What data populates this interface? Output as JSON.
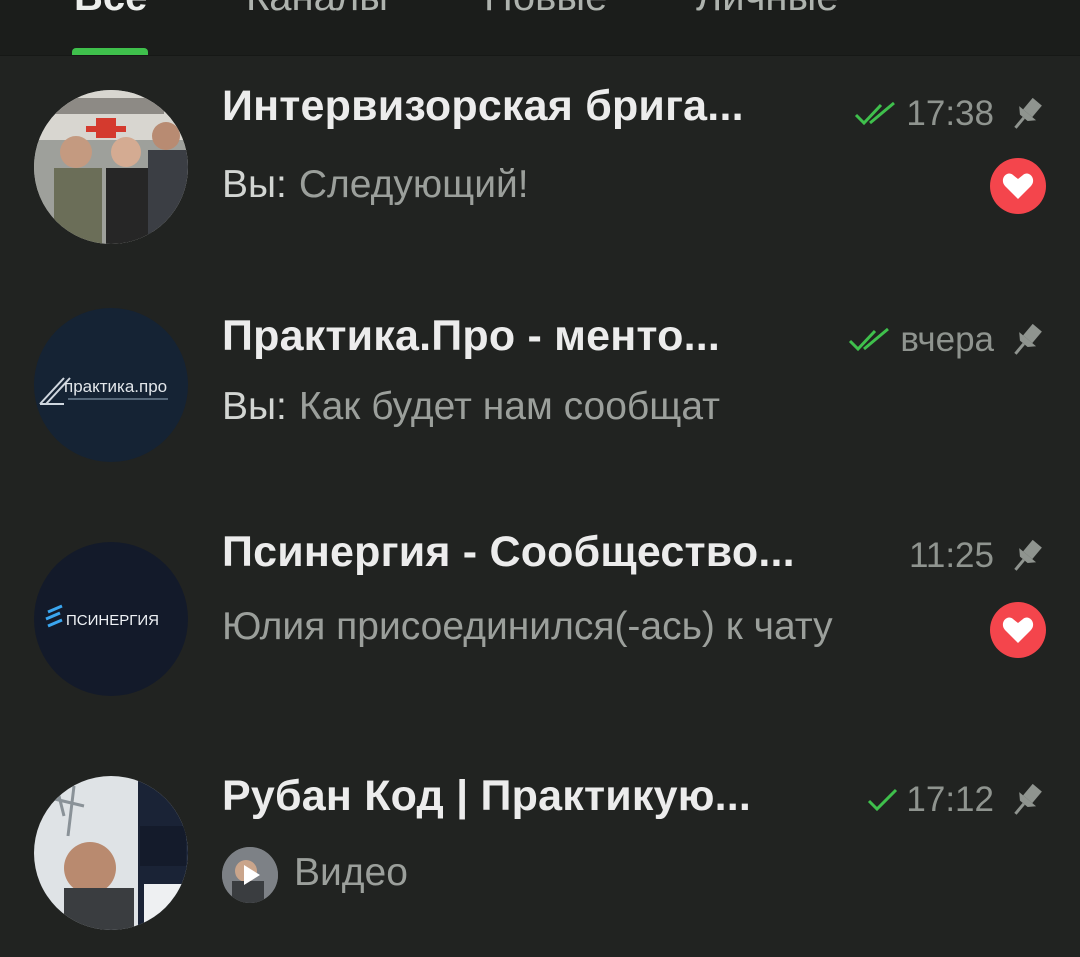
{
  "tabs": [
    {
      "label": "Все",
      "active": true
    },
    {
      "label": "Каналы",
      "active": false
    },
    {
      "label": "Новые",
      "active": false
    },
    {
      "label": "Личные",
      "active": false
    }
  ],
  "colors": {
    "accent": "#3fc04c",
    "background": "#212321",
    "reaction": "#f4454c",
    "check": "#3fc04c"
  },
  "chats": [
    {
      "title": "Интервизорская брига...",
      "time": "17:38",
      "read_status": "double-check",
      "pinned": true,
      "sender": "Вы:",
      "preview": "Следующий!",
      "reaction": "heart-icon"
    },
    {
      "title": "Практика.Про - менто...",
      "time": "вчера",
      "read_status": "double-check",
      "pinned": true,
      "sender": "Вы:",
      "preview": "Как будет нам сообщат",
      "avatar_text": "практика.про"
    },
    {
      "title": "Псинергия - Сообщество...",
      "time": "11:25",
      "read_status": "none",
      "pinned": true,
      "preview": "Юлия присоединился(-ась) к чату",
      "reaction": "heart-icon",
      "avatar_text": "ПСИНЕРГИЯ"
    },
    {
      "title": "Рубан Код | Практикую...",
      "time": "17:12",
      "read_status": "single-check",
      "pinned": true,
      "preview": "Видео",
      "media": "video-thumbnail"
    }
  ]
}
